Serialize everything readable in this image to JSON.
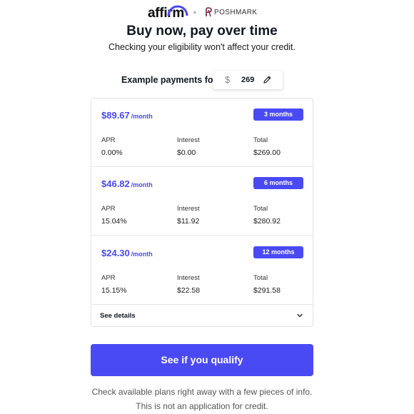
{
  "brand": {
    "affirm_logo": "affirm",
    "separator": "+",
    "partner_name": "POSHMARK",
    "accent_color": "#4a4af4"
  },
  "header": {
    "title": "Buy now, pay over time",
    "subtitle": "Checking your eligibility won't affect your credit."
  },
  "amount": {
    "label": "Example payments for",
    "currency_symbol": "$",
    "value": "269"
  },
  "plan_columns": [
    "APR",
    "Interest",
    "Total"
  ],
  "plans": [
    {
      "price": "$89.67",
      "per": "/month",
      "term": "3 months",
      "apr": "0.00%",
      "interest": "$0.00",
      "total": "$269.00"
    },
    {
      "price": "$46.82",
      "per": "/month",
      "term": "6 months",
      "apr": "15.04%",
      "interest": "$11.92",
      "total": "$280.92"
    },
    {
      "price": "$24.30",
      "per": "/month",
      "term": "12 months",
      "apr": "15.15%",
      "interest": "$22.58",
      "total": "$291.58"
    }
  ],
  "details": {
    "label": "See details"
  },
  "cta": {
    "label": "See if you qualify"
  },
  "footnote": {
    "line1": "Check available plans right away with a few pieces of info.",
    "line2": "This is not an application for credit."
  }
}
